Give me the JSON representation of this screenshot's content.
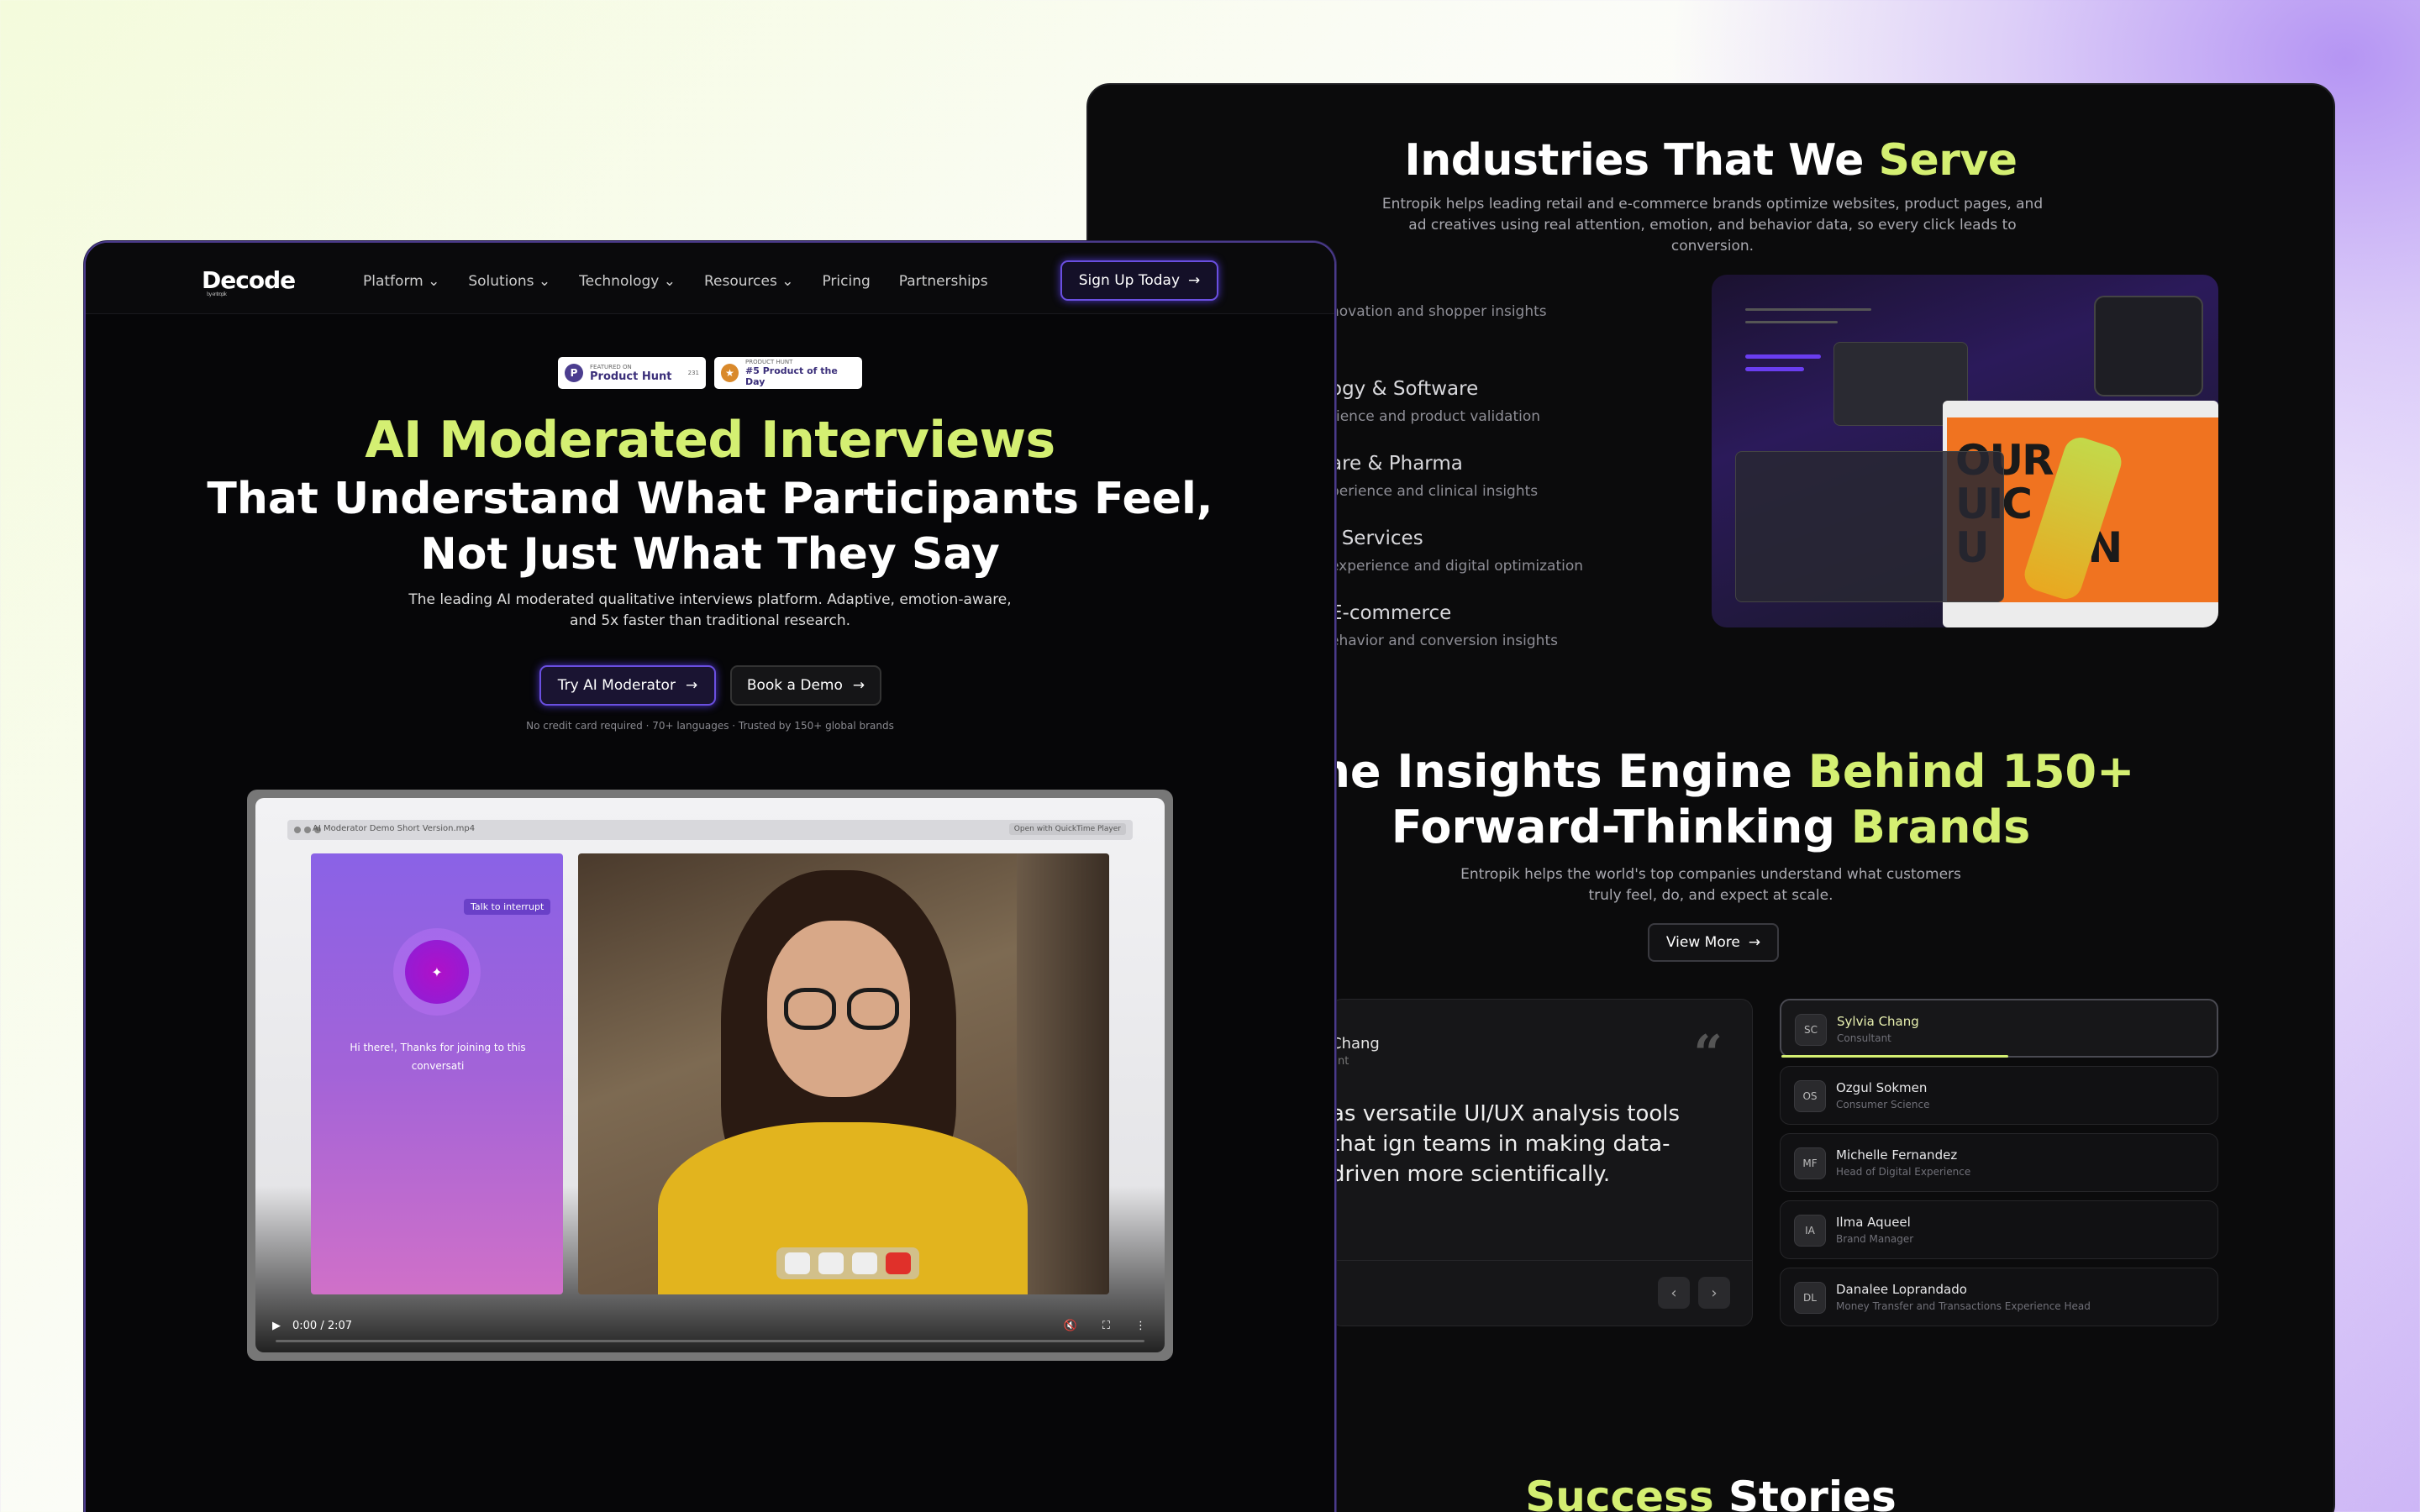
{
  "right": {
    "industries_title_a": "Industries That We ",
    "industries_title_b": "Serve",
    "industries_sub": "Entropik helps leading retail and e-commerce brands optimize websites, product pages, and ad creatives using real attention, emotion, and behavior data, so every click leads to conversion.",
    "industries": [
      {
        "heading": "",
        "desc": "novation and shopper insights"
      },
      {
        "heading": "ogy & Software",
        "desc": "rience and product validation"
      },
      {
        "heading": "are & Pharma",
        "desc": "perience and clinical insights"
      },
      {
        "heading": "l Services",
        "desc": "experience and digital optimization"
      },
      {
        "heading": "E-commerce",
        "desc": "ehavior and conversion insights"
      }
    ],
    "mock_big_text": "OUR\nUIC\nU    ION",
    "insights_title_a": "The Insights Engine ",
    "insights_title_b": "Behind 150+",
    "insights_title_c": "Forward-Thinking ",
    "insights_title_d": "Brands",
    "insights_sub": "Entropik helps the world's top companies understand what customers truly feel, do, and expect at scale.",
    "view_more": "View More",
    "quote": {
      "name": "Chang",
      "role": "ant",
      "text": "as versatile UI/UX analysis tools that ign teams in making data-driven more scientifically.",
      "mark": "“"
    },
    "people": [
      {
        "initials": "SC",
        "name": "Sylvia Chang",
        "role": "Consultant",
        "active": true
      },
      {
        "initials": "OS",
        "name": "Ozgul Sokmen",
        "role": "Consumer Science"
      },
      {
        "initials": "MF",
        "name": "Michelle Fernandez",
        "role": "Head of Digital Experience"
      },
      {
        "initials": "IA",
        "name": "Ilma Aqueel",
        "role": "Brand Manager"
      },
      {
        "initials": "DL",
        "name": "Danalee Loprandado",
        "role": "Money Transfer and Transactions Experience Head"
      }
    ],
    "success_a": "Success",
    "success_b": " Stories"
  },
  "left": {
    "logo": "Decode",
    "logo_small": "by entropik",
    "menu": [
      "Platform ⌄",
      "Solutions ⌄",
      "Technology ⌄",
      "Resources ⌄",
      "Pricing",
      "Partnerships"
    ],
    "signup": "Sign Up Today",
    "badge1_small": "FEATURED ON",
    "badge1_main": "Product Hunt",
    "badge1_count": "231",
    "badge2_small": "PRODUCT HUNT",
    "badge2_main": "#5 Product of the Day",
    "hero_a": "AI Moderated Interviews",
    "hero_b1": "That Understand What Participants Feel,",
    "hero_b2": "Not Just What They Say",
    "hero_sub1": "The leading AI moderated qualitative interviews platform. Adaptive, emotion-aware,",
    "hero_sub2": "and 5x faster than traditional research.",
    "cta_primary": "Try AI Moderator",
    "cta_secondary": "Book a Demo",
    "note": "No credit card required · 70+ languages · Trusted by 150+ global brands",
    "video": {
      "title": "AI Moderator Demo Short Version.mp4",
      "open_with": "Open with QuickTime Player",
      "interrupt": "Talk to interrupt",
      "greeting": "Hi there!, Thanks for joining to this conversati",
      "time": "0:00 / 2:07"
    }
  }
}
